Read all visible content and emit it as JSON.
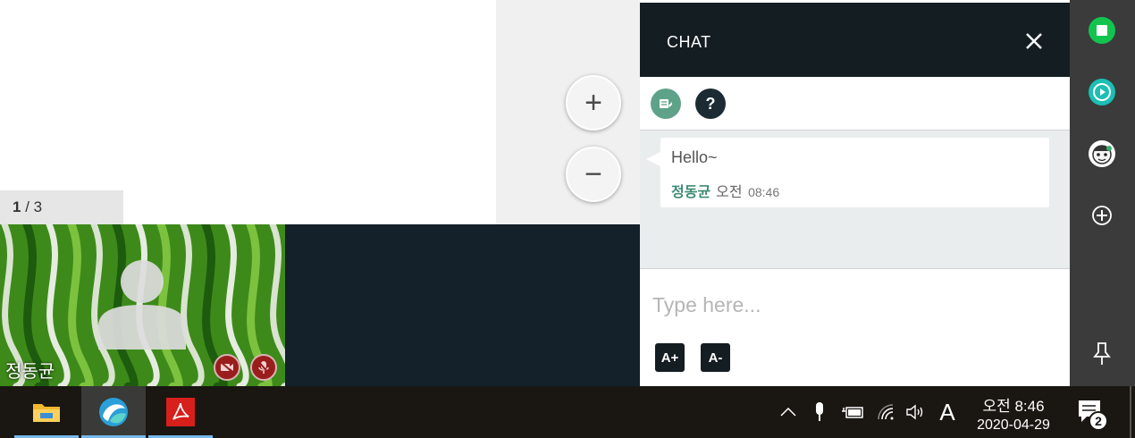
{
  "document": {
    "page_current": "1",
    "page_sep": " / ",
    "page_total": "3",
    "zoom_in_label": "+",
    "zoom_out_label": "−"
  },
  "video": {
    "participant_name": "정동균",
    "camera_status": "off",
    "mic_status": "muted"
  },
  "chat": {
    "title": "CHAT",
    "help_label": "?",
    "messages": [
      {
        "text": "Hello~",
        "sender": "정동균",
        "ampm": "오전",
        "time": "08:46"
      }
    ],
    "input_placeholder": "Type here...",
    "font_increase_label": "A+",
    "font_decrease_label": "A-"
  },
  "sidebar": {
    "icons": [
      "stop-icon",
      "play-icon",
      "character-icon",
      "add-icon",
      "pin-icon"
    ]
  },
  "taskbar": {
    "apps": [
      "file-explorer-icon",
      "browser-app-icon",
      "acrobat-icon"
    ],
    "ime_label": "A",
    "clock_time": "오전 8:46",
    "clock_date": "2020-04-29",
    "notification_count": "2"
  },
  "colors": {
    "header_bg": "#141d22",
    "sender": "#3f8c74",
    "memo_button": "#5ea28a",
    "sidebar_bg": "#3b3b3b"
  }
}
